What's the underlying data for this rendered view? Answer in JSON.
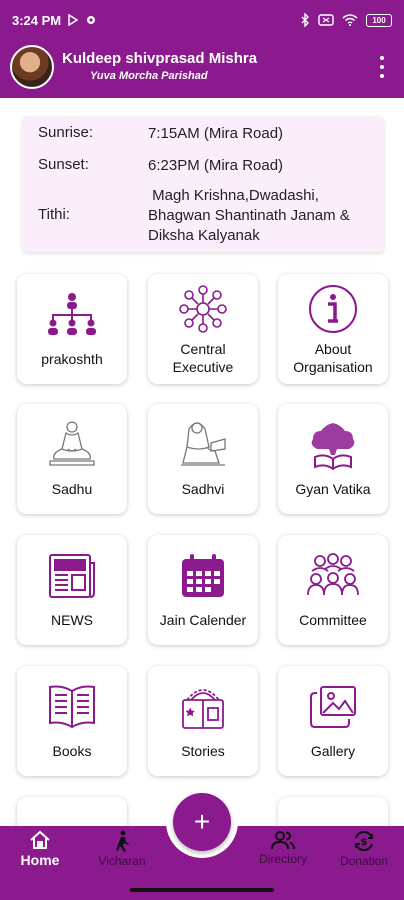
{
  "status_bar": {
    "time": "3:24 PM",
    "battery": "100"
  },
  "header": {
    "user_name": "Kuldeep shivprasad Mishra",
    "organisation": "Yuva Morcha Parishad"
  },
  "info": {
    "sunrise_label": "Sunrise:",
    "sunrise_value": "7:15AM (Mira Road)",
    "sunset_label": "Sunset:",
    "sunset_value": "6:23PM (Mira Road)",
    "tithi_label": "Tithi:",
    "tithi_value": " Magh Krishna,Dwadashi, Bhagwan Shantinath Janam & Diksha Kalyanak"
  },
  "tiles": [
    {
      "label": "prakoshth",
      "icon": "org-chart-icon"
    },
    {
      "label": "Central Executive",
      "icon": "network-icon"
    },
    {
      "label": "About Organisation",
      "icon": "info-icon"
    },
    {
      "label": "Sadhu",
      "icon": "meditating-monk-icon"
    },
    {
      "label": "Sadhvi",
      "icon": "nun-icon"
    },
    {
      "label": "Gyan Vatika",
      "icon": "tree-book-icon"
    },
    {
      "label": "NEWS",
      "icon": "newspaper-icon"
    },
    {
      "label": "Jain Calender",
      "icon": "calendar-icon"
    },
    {
      "label": "Committee",
      "icon": "group-icon"
    },
    {
      "label": "Books",
      "icon": "open-book-icon"
    },
    {
      "label": "Stories",
      "icon": "storybook-icon"
    },
    {
      "label": "Gallery",
      "icon": "gallery-icon"
    }
  ],
  "bottom_nav": {
    "home": "Home",
    "vicharan": "Vicharan",
    "fab": "+",
    "directory": "Directory",
    "donation": "Donation"
  },
  "colors": {
    "primary": "#8b1a8f",
    "card_bg": "#fbeefb"
  }
}
